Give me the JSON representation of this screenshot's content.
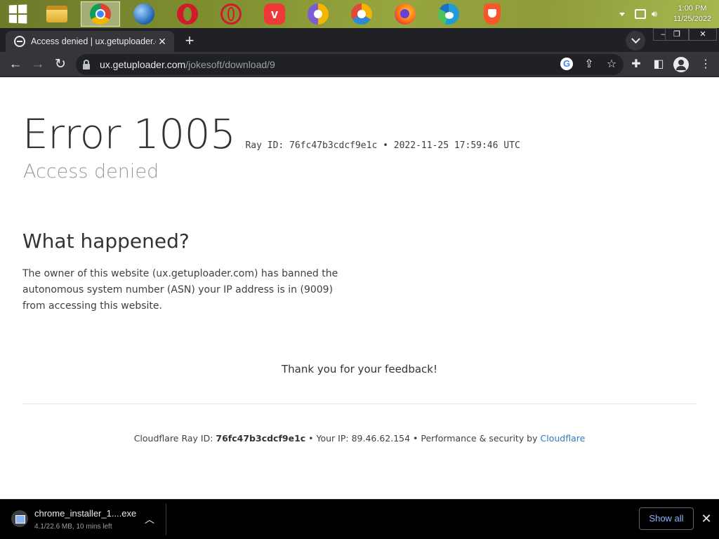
{
  "taskbar": {
    "apps": [
      {
        "name": "start-button",
        "icon": "windows-logo-icon"
      },
      {
        "name": "file-explorer",
        "icon": "folder-icon"
      },
      {
        "name": "chrome",
        "icon": "chrome-icon",
        "active": true
      },
      {
        "name": "globe-browser",
        "icon": "globe-icon"
      },
      {
        "name": "opera",
        "icon": "opera-icon"
      },
      {
        "name": "opera-gx",
        "icon": "opera-outline-icon"
      },
      {
        "name": "vivaldi",
        "icon": "vivaldi-icon"
      },
      {
        "name": "browser-a",
        "icon": "keyhole-browser-icon"
      },
      {
        "name": "browser-b",
        "icon": "keyhole-browser-icon"
      },
      {
        "name": "firefox",
        "icon": "firefox-icon"
      },
      {
        "name": "edge",
        "icon": "edge-icon"
      },
      {
        "name": "brave",
        "icon": "brave-icon"
      }
    ],
    "clock_time": "1:00 PM",
    "clock_date": "11/25/2022"
  },
  "browser": {
    "tab_title": "Access denied | ux.getuploader.com",
    "tab_close": "✕",
    "new_tab": "+",
    "url_host": "ux.getuploader.com",
    "url_path": "/jokesoft/download/9",
    "google_badge": "G",
    "window_min": "—",
    "window_restore": "❐",
    "window_close": "✕"
  },
  "page": {
    "error_code": "Error 1005",
    "ray_meta": "Ray ID: 76fc47b3cdcf9e1c • 2022-11-25 17:59:46 UTC",
    "subtitle": "Access denied",
    "what_happened_heading": "What happened?",
    "explanation": "The owner of this website (ux.getuploader.com) has banned the autonomous system number (ASN) your IP address is in (9009) from accessing this website.",
    "thanks": "Thank you for your feedback!",
    "footer": {
      "ray_label": "Cloudflare Ray ID: ",
      "ray_id": "76fc47b3cdcf9e1c",
      "ip_label": " • Your IP: ",
      "ip": "89.46.62.154",
      "perf_label": " • Performance & security by ",
      "cloudflare_link": "Cloudflare"
    }
  },
  "downloads": {
    "file_name": "chrome_installer_1....exe",
    "status": "4.1/22.6 MB, 10 mins left",
    "show_all": "Show all",
    "close": "✕"
  },
  "colors": {
    "chrome_dark": "#202124",
    "tab_active": "#35363a",
    "link_blue": "#2f7bbf",
    "show_all_blue": "#8ab4f8"
  }
}
